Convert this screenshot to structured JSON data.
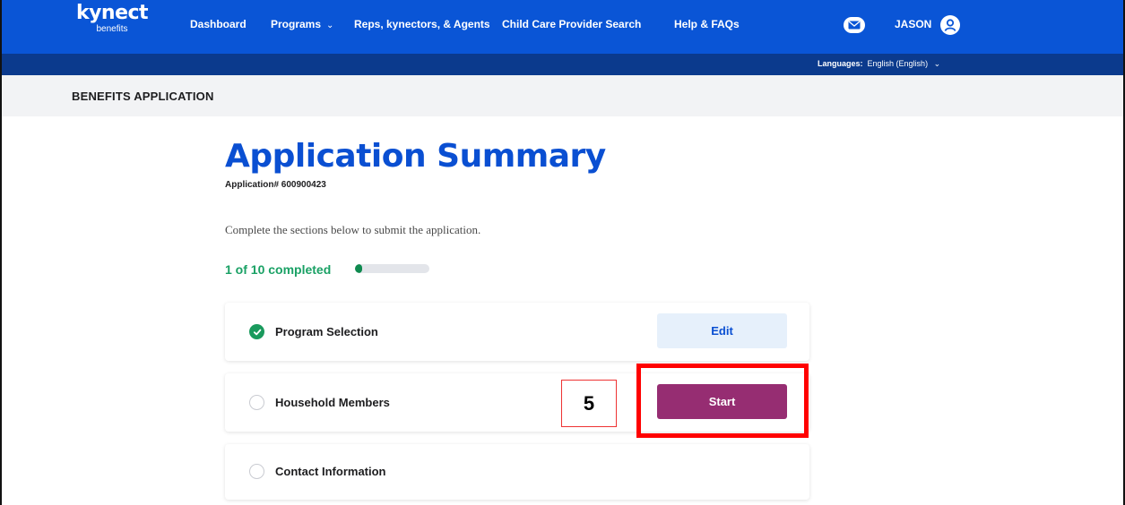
{
  "nav": {
    "logo_brand": "kynect",
    "logo_sub": "benefits",
    "items": [
      {
        "label": "Dashboard"
      },
      {
        "label": "Programs",
        "has_dropdown": true
      },
      {
        "label": "Reps, kynectors, & Agents"
      },
      {
        "label": "Child Care Provider Search"
      },
      {
        "label": "Help & FAQs"
      }
    ],
    "mail_icon": "mail-icon",
    "user_name": "JASON",
    "user_icon": "user-avatar-icon",
    "bg_color": "#0a55d6"
  },
  "language_bar": {
    "label": "Languages:",
    "value": "English (English)",
    "bg_color": "#0b3a8d"
  },
  "page_header": {
    "title": "BENEFITS APPLICATION"
  },
  "summary": {
    "title": "Application Summary",
    "app_number": "Application# 600900423",
    "instruction": "Complete the sections below to submit the application.",
    "progress_label": "1 of 10 completed",
    "progress_completed": 1,
    "progress_total": 10,
    "sections": [
      {
        "label": "Program Selection",
        "status": "completed",
        "action": "Edit"
      },
      {
        "label": "Household Members",
        "status": "not-started",
        "action": "Start"
      },
      {
        "label": "Contact Information",
        "status": "not-started",
        "action": ""
      }
    ]
  },
  "annotation": {
    "step_number": "5",
    "highlight_color": "#ff0000"
  }
}
